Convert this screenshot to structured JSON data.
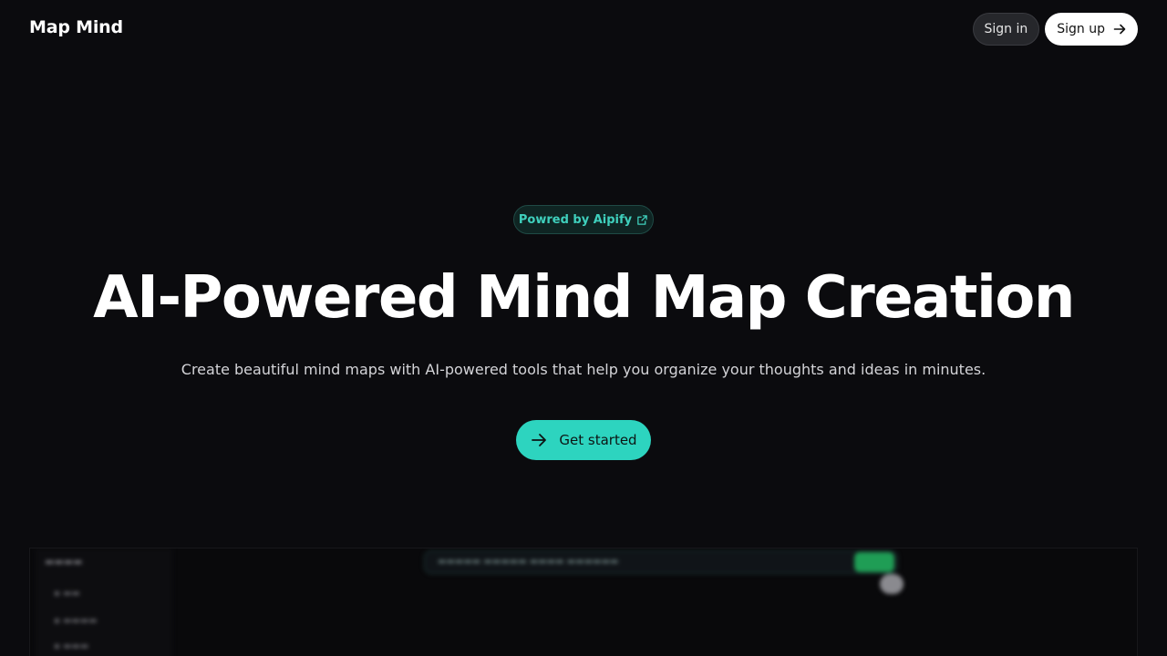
{
  "header": {
    "brand": "Map Mind",
    "sign_in_label": "Sign in",
    "sign_up_label": "Sign up"
  },
  "hero": {
    "badge_label": "Powred by Aipify",
    "title": "AI-Powered Mind Map Creation",
    "subtitle": "Create beautiful mind maps with AI-powered tools that help you organize your thoughts and ideas in minutes.",
    "cta_label": "Get started"
  },
  "icons": {
    "sign_up": "arrow-right-icon",
    "badge": "external-link-icon",
    "cta": "arrow-right-icon"
  },
  "colors": {
    "background": "#0b0b0e",
    "accent": "#2dd4bf",
    "badge_text": "#3fd0bd",
    "preview_button": "#1f9d55"
  }
}
